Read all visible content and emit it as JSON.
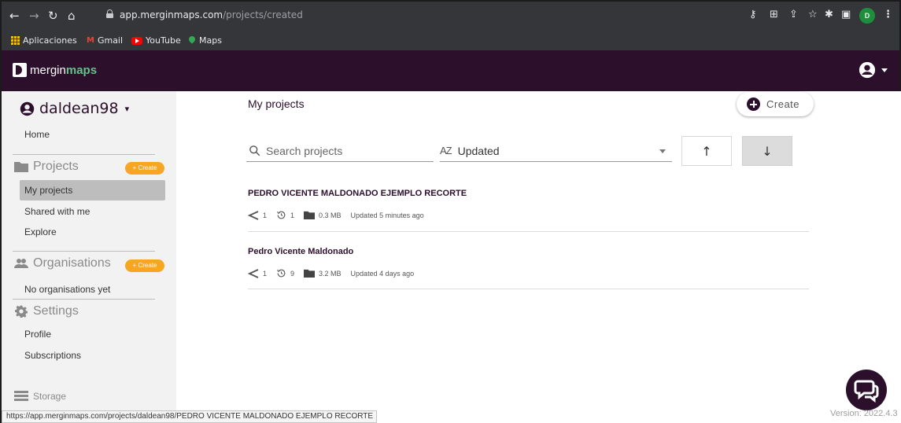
{
  "browser": {
    "url_host": "app.merginmaps.com",
    "url_path": "/projects/created",
    "profile_initial": "D",
    "bookmarks": [
      {
        "label": "Aplicaciones",
        "icon": "apps-grid-icon"
      },
      {
        "label": "Gmail",
        "icon": "gmail-icon"
      },
      {
        "label": "YouTube",
        "icon": "youtube-icon"
      },
      {
        "label": "Maps",
        "icon": "maps-icon"
      }
    ]
  },
  "app": {
    "logo_prefix": "mergin",
    "logo_suffix": "maps"
  },
  "sidebar": {
    "username": "daldean98",
    "home": "Home",
    "projects_heading": "Projects",
    "projects_create": "+ Create",
    "my_projects": "My projects",
    "shared_with_me": "Shared with me",
    "explore": "Explore",
    "organisations_heading": "Organisations",
    "organisations_create": "+ Create",
    "no_organisations": "No organisations yet",
    "settings_heading": "Settings",
    "profile": "Profile",
    "subscriptions": "Subscriptions",
    "storage": "Storage",
    "accent_color": "#f6a623"
  },
  "main": {
    "title": "My projects",
    "create_label": "Create",
    "search_placeholder": "Search projects",
    "sort_icon_text": "AZ",
    "sort_value": "Updated",
    "projects": [
      {
        "name": "PEDRO VICENTE MALDONADO EJEMPLO RECORTE",
        "shares": "1",
        "versions": "1",
        "size": "0.3 MB",
        "updated": "Updated 5 minutes ago"
      },
      {
        "name": "Pedro Vicente Maldonado",
        "shares": "1",
        "versions": "9",
        "size": "3.2 MB",
        "updated": "Updated 4 days ago"
      }
    ]
  },
  "footer": {
    "version": "Version: 2022.4.3",
    "status_url": "https://app.merginmaps.com/projects/daldean98/PEDRO VICENTE MALDONADO EJEMPLO RECORTE"
  },
  "colors": {
    "brand_dark": "#2b0f2b",
    "brand_green": "#63c38b",
    "sidebar_bg": "#f2f2f2",
    "active_item_bg": "#bdbdbd"
  }
}
